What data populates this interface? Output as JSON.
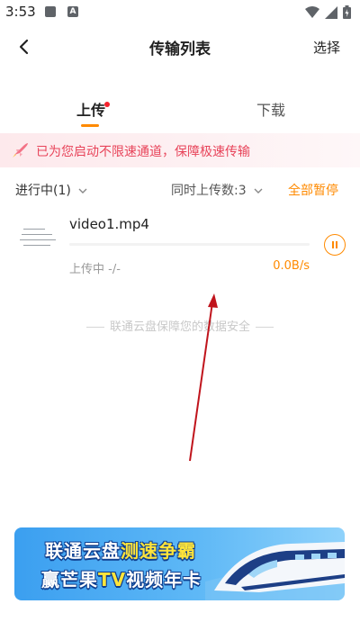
{
  "status_bar": {
    "time": "3:53"
  },
  "header": {
    "title": "传输列表",
    "select_label": "选择"
  },
  "tabs": [
    {
      "label": "上传"
    },
    {
      "label": "下载"
    }
  ],
  "notice": {
    "text": "已为您启动不限速通道，保障极速传输"
  },
  "filters": {
    "progress_label": "进行中(1)",
    "concurrency_label": "同时上传数:3",
    "pause_all_label": "全部暂停"
  },
  "transfer_items": [
    {
      "file_name": "video1.mp4",
      "status": "上传中  -/-",
      "speed": "0.0B/s",
      "progress": 0.0
    }
  ],
  "security_note": "联通云盘保障您的数据安全",
  "promo": {
    "line1_a": "联通云盘",
    "line1_b": "测速争霸",
    "line2_a": "赢芒果",
    "line2_b": "TV",
    "line2_c": "视频年卡"
  },
  "colors": {
    "accent": "#ff8a00",
    "notice_text": "#e8445a",
    "annotation_arrow": "#c0141c"
  }
}
